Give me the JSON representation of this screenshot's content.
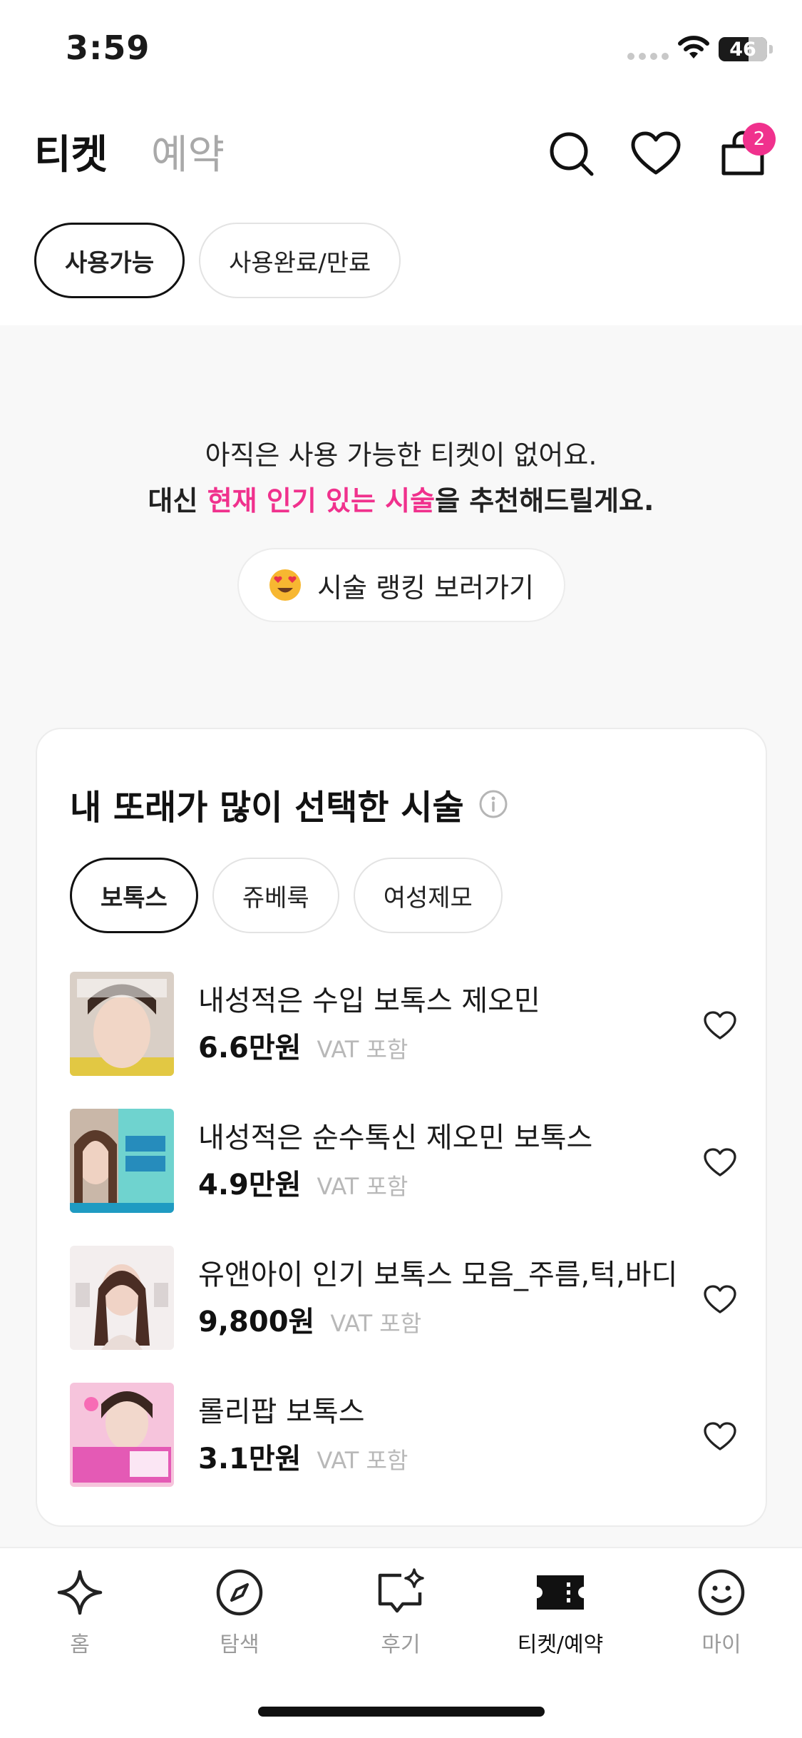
{
  "status_bar": {
    "time": "3:59",
    "battery": "46"
  },
  "header": {
    "tabs": [
      {
        "label": "티켓",
        "active": true
      },
      {
        "label": "예약",
        "active": false
      }
    ],
    "icons": [
      "search-icon",
      "heart-icon",
      "shopping-bag-icon"
    ],
    "cart_count": "2"
  },
  "filters": [
    {
      "label": "사용가능",
      "active": true
    },
    {
      "label": "사용완료/만료",
      "active": false
    }
  ],
  "empty_state": {
    "line1": "아직은 사용 가능한 티켓이 없어요.",
    "line2_prefix": "대신 ",
    "line2_highlight": "현재 인기 있는 시술",
    "line2_suffix": "을 추천해드릴게요.",
    "button_label": "시술 랭킹 보러가기"
  },
  "recommend": {
    "title": "내 또래가 많이 선택한 시술",
    "chips": [
      {
        "label": "보톡스",
        "active": true
      },
      {
        "label": "쥬베룩",
        "active": false
      },
      {
        "label": "여성제모",
        "active": false
      }
    ],
    "products": [
      {
        "name": "내성적은 수입 보톡스 제오민",
        "price": "6.6만원",
        "vat": "VAT 포함"
      },
      {
        "name": "내성적은 순수톡신 제오민 보톡스",
        "price": "4.9만원",
        "vat": "VAT 포함"
      },
      {
        "name": "유앤아이 인기 보톡스 모음_주름,턱,바디",
        "price": "9,800원",
        "vat": "VAT 포함"
      },
      {
        "name": "롤리팝 보톡스",
        "price": "3.1만원",
        "vat": "VAT 포함"
      }
    ]
  },
  "bottom_nav": [
    {
      "label": "홈",
      "icon": "sparkle-icon",
      "active": false
    },
    {
      "label": "탐색",
      "icon": "compass-icon",
      "active": false
    },
    {
      "label": "후기",
      "icon": "review-bubble-icon",
      "active": false
    },
    {
      "label": "티켓/예약",
      "icon": "ticket-icon",
      "active": true
    },
    {
      "label": "마이",
      "icon": "smiley-icon",
      "active": false
    }
  ],
  "colors": {
    "accent_pink": "#f0318d",
    "background_gray": "#f8f8f8"
  }
}
